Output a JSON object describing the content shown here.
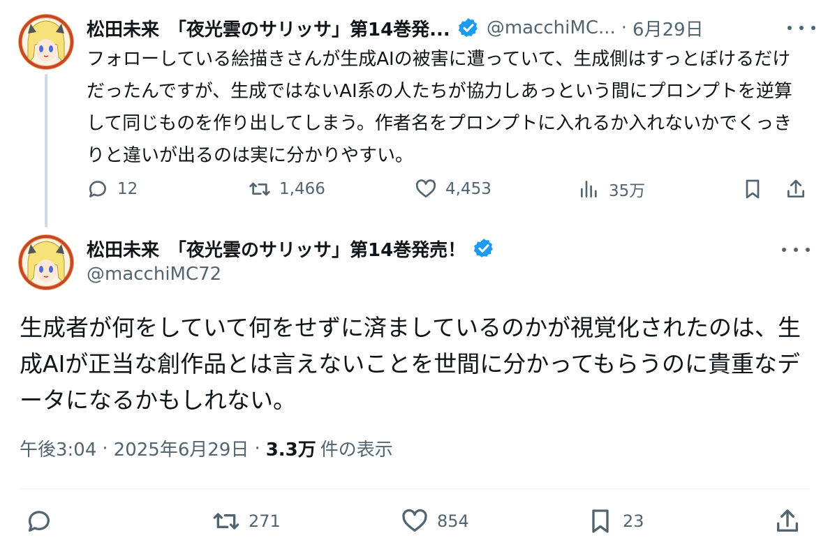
{
  "colors": {
    "verified": "#1d9bf0",
    "secondary_text": "#536471",
    "primary_text": "#0f1419"
  },
  "tweet1": {
    "display_name": "松田未来　「夜光雲のサリッサ」第14巻発...",
    "handle": "@macchiMC...",
    "separator": "·",
    "date": "6月29日",
    "body": "フォローしている絵描きさんが生成AIの被害に遭っていて、生成側はすっとぼけるだけだったんですが、生成ではないAI系の人たちが協力しあっという間にプロンプトを逆算して同じものを作り出してしまう。作者名をプロンプトに入れるか入れないかでくっきりと違いが出るのは実に分かりやすい。",
    "actions": {
      "replies": "12",
      "retweets": "1,466",
      "likes": "4,453",
      "views": "35万"
    }
  },
  "tweet2": {
    "display_name": "松田未来　「夜光雲のサリッサ」第14巻発売！",
    "handle": "@macchiMC72",
    "body": "生成者が何をしていて何をせずに済ましているのかが視覚化されたのは、生成AIが正当な創作品とは言えないことを世間に分かってもらうのに貴重なデータになるかもしれない。",
    "meta": {
      "time": "午後3:04",
      "separator1": "·",
      "date": "2025年6月29日",
      "separator2": "·",
      "views_count": "3.3万",
      "views_label": "件の表示"
    },
    "actions": {
      "retweets": "271",
      "likes": "854",
      "bookmarks": "23"
    }
  },
  "icons": [
    "avatar",
    "verified-badge-icon",
    "more-icon",
    "reply-icon",
    "retweet-icon",
    "like-icon",
    "views-icon",
    "bookmark-icon",
    "share-icon"
  ]
}
